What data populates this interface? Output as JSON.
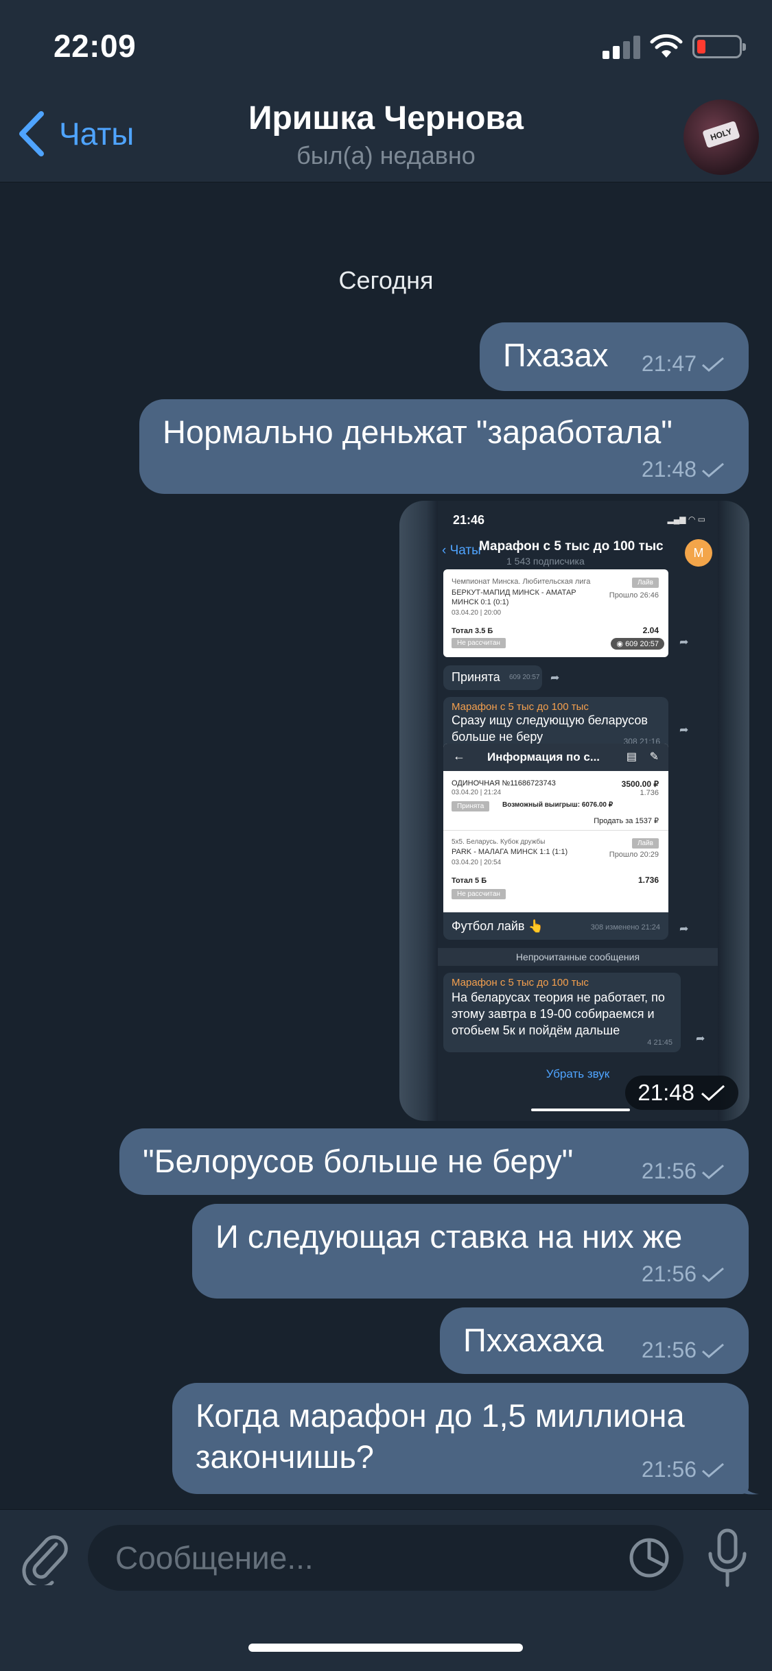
{
  "status_bar": {
    "time": "22:09"
  },
  "header": {
    "back_label": "Чаты",
    "title": "Иришка Чернова",
    "subtitle": "был(а) недавно"
  },
  "date_label": "Сегодня",
  "messages": [
    {
      "text": "Пхазах",
      "time": "21:47"
    },
    {
      "text": "Нормально деньжат \"заработала\"",
      "time": "21:48"
    },
    {
      "text": "\"Белорусов больше не беру\"",
      "time": "21:56"
    },
    {
      "text": "И следующая ставка на них же",
      "time": "21:56"
    },
    {
      "text": "Пххахаха",
      "time": "21:56"
    },
    {
      "line1": "Когда марафон до 1,5 миллиона",
      "line2": "закончишь?",
      "time": "21:56"
    }
  ],
  "image_message": {
    "time": "21:48",
    "screenshot": {
      "time": "21:46",
      "back_label": "Чаты",
      "channel_title": "Марафон с 5 тыс до 100 тыс",
      "channel_subscribers": "1 543 подписчика",
      "avatar_letter": "М",
      "bet1": {
        "league": "Чемпионат Минска. Любительская лига",
        "status": "Лайв",
        "match": "БЕРКУТ-МАПИД МИНСК - АМАТАР",
        "match2": "МИНСК 0:1 (0:1)",
        "elapsed": "Прошло 26:46",
        "date": "03.04.20 | 20:00",
        "bet": "Тотал 3.5 Б",
        "odds": "2.04",
        "result": "Не рассчитан",
        "views": "609 20:57"
      },
      "accepted": {
        "text": "Принята",
        "meta": "609 20:57"
      },
      "msg2": {
        "author": "Марафон с 5 тыс до 100 тыс",
        "line1": "Сразу ищу следующую беларусов",
        "line2": "больше не беру",
        "meta": "308 21:16"
      },
      "info_card": {
        "title": "Информация по с...",
        "single": "ОДИНОЧНАЯ №11686723743",
        "amount": "3500.00 ₽",
        "date": "03.04.20 | 21:24",
        "odds": "1.736",
        "status": "Принята",
        "win": "Возможный выигрыш: 6076.00 ₽",
        "sell": "Продать за 1537 ₽",
        "league": "5x5. Беларусь. Кубок дружбы",
        "live": "Лайв",
        "match": "PARK - МАЛАГА МИНСК 1:1 (1:1)",
        "elapsed": "Прошло 20:29",
        "date2": "03.04.20 | 20:54",
        "bet": "Тотал 5 Б",
        "odds2": "1.736",
        "result": "Не рассчитан"
      },
      "football": {
        "text": "Футбол лайв 👆",
        "meta": "308 изменено 21:24"
      },
      "unread_label": "Непрочитанные сообщения",
      "msg3": {
        "author": "Марафон с 5 тыс до 100 тыс",
        "line1": "На беларусах теория не работает, по",
        "line2": "этому завтра в 19-00 собираемся и",
        "line3": "отобьем 5к и пойдём дальше",
        "meta": "4 21:45"
      },
      "mute_label": "Убрать звук"
    }
  },
  "input": {
    "placeholder": "Сообщение..."
  },
  "colors": {
    "background": "#18222d",
    "header": "#212d3b",
    "bubble_out": "#4b6482",
    "accent": "#4fa4ff"
  },
  "icons": [
    "chevron-left-icon",
    "signal-icon",
    "wifi-icon",
    "battery-icon",
    "check-icon",
    "attach-icon",
    "sticker-icon",
    "microphone-icon",
    "forward-icon"
  ]
}
